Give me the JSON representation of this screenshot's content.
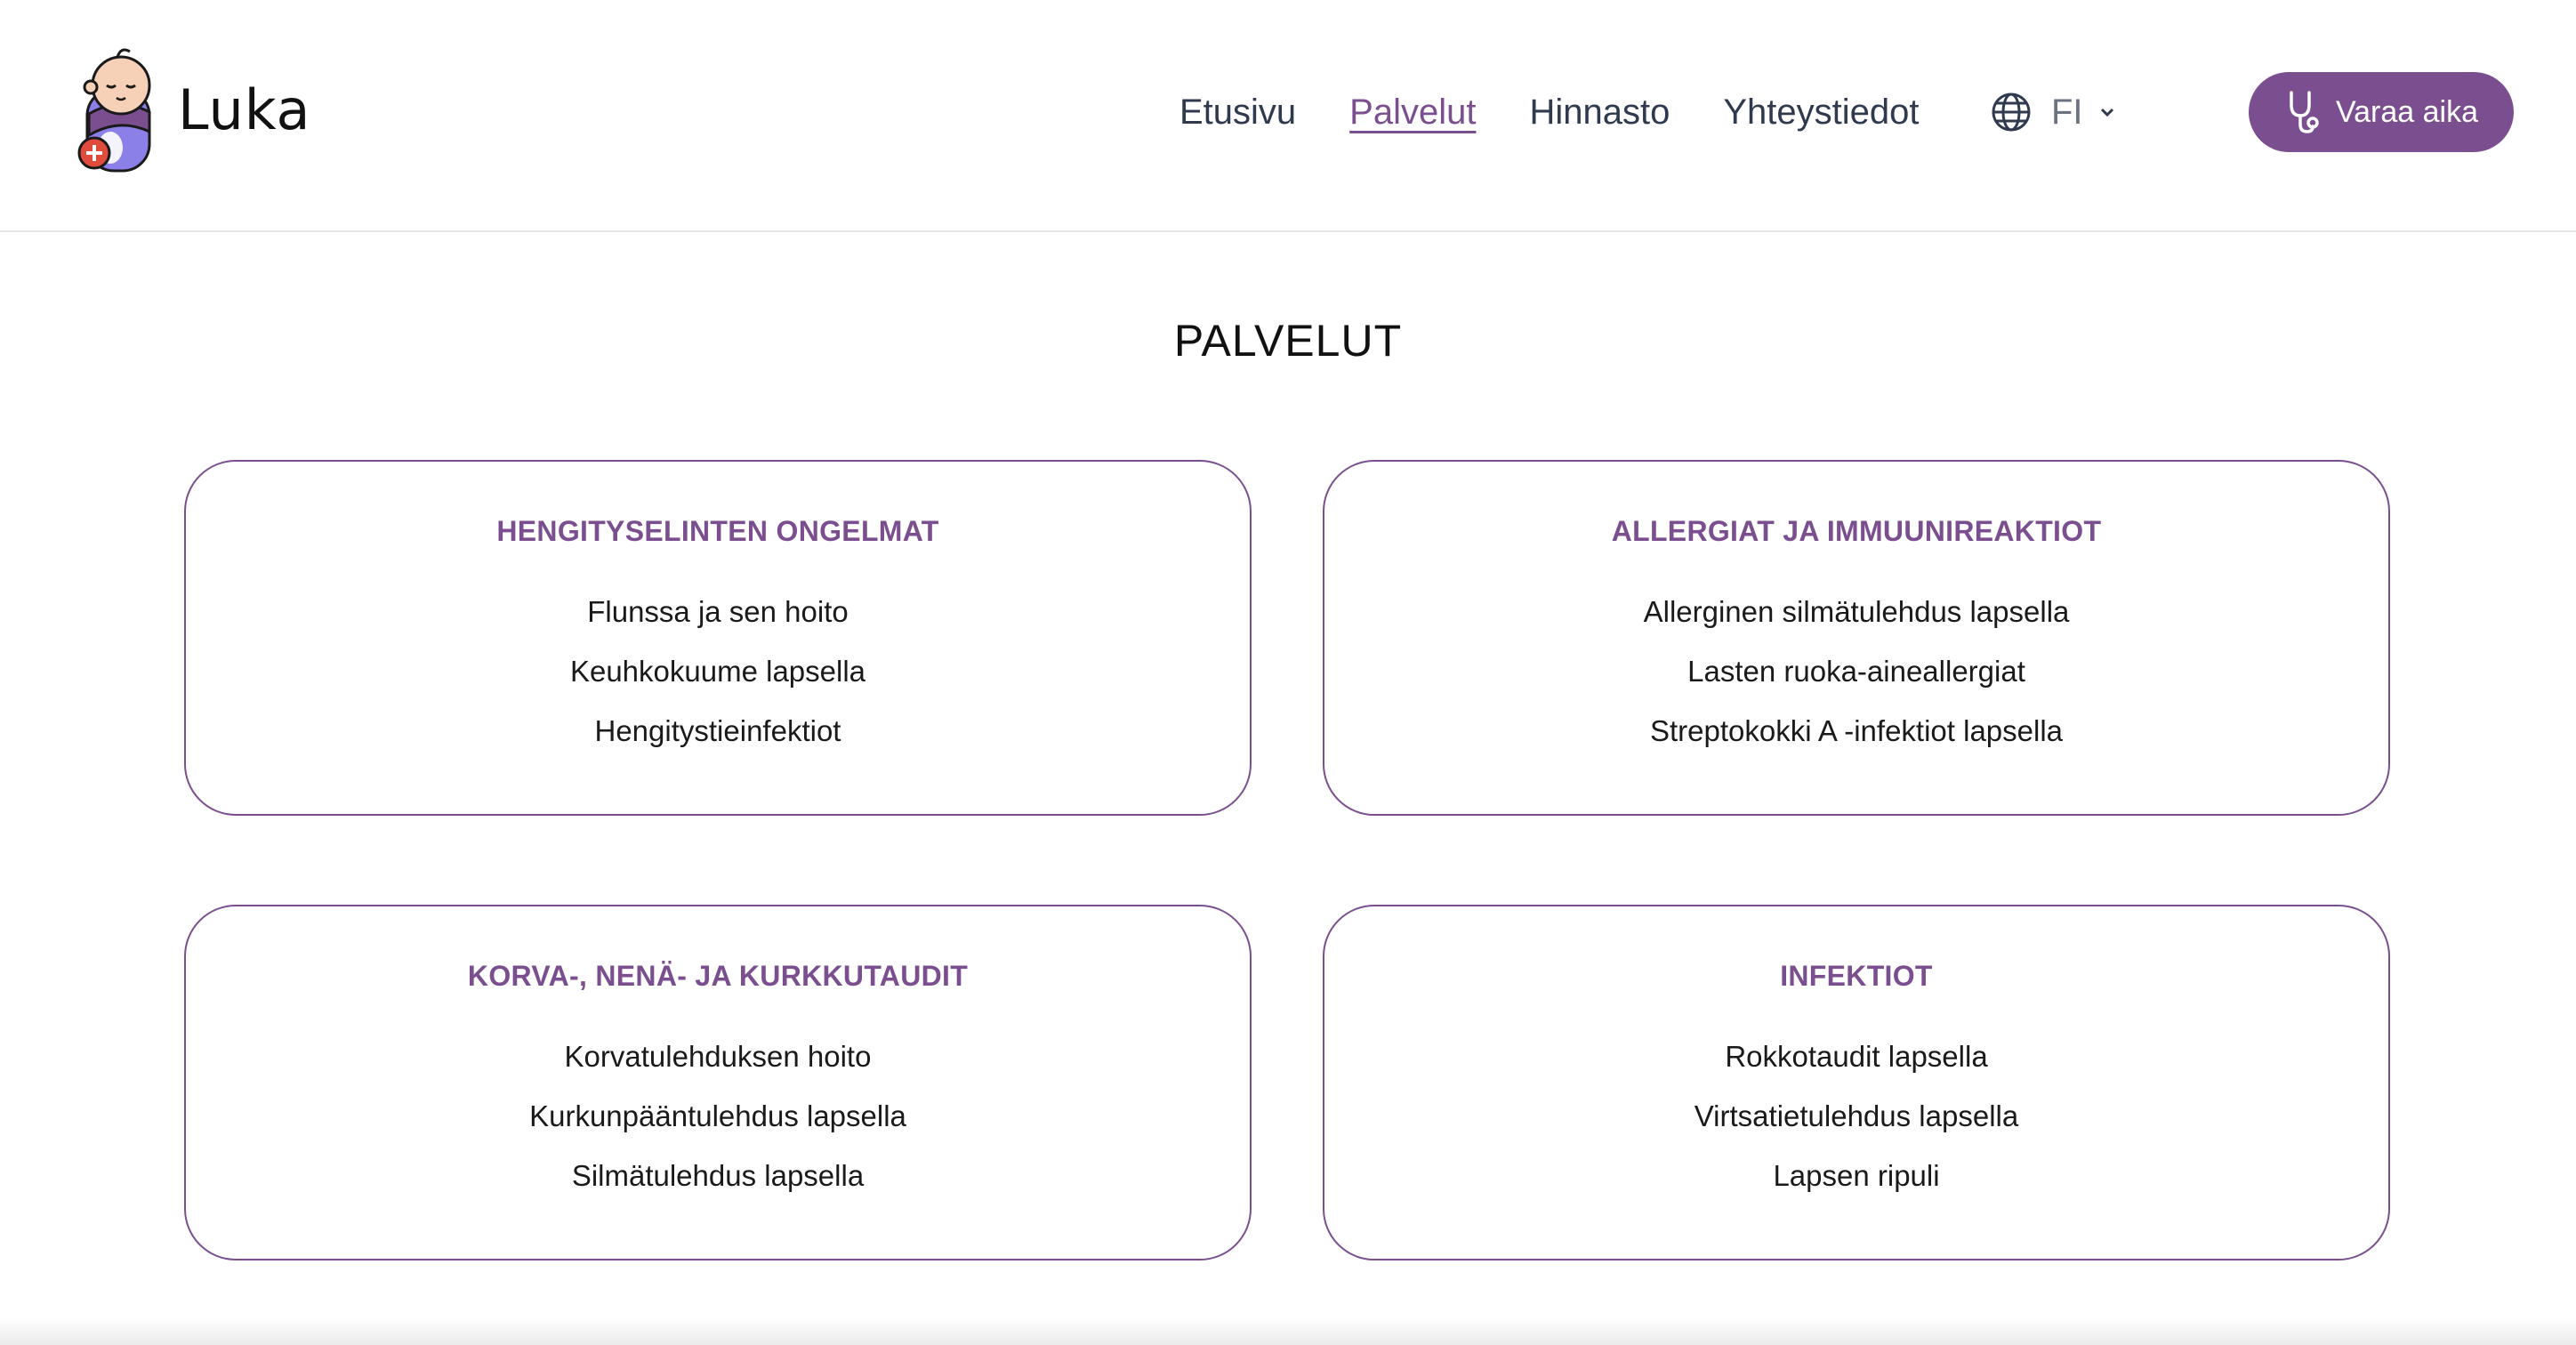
{
  "brand": {
    "name": "Luka",
    "accent": "#7b4f8f"
  },
  "nav": {
    "items": [
      {
        "label": "Etusivu",
        "active": false
      },
      {
        "label": "Palvelut",
        "active": true
      },
      {
        "label": "Hinnasto",
        "active": false
      },
      {
        "label": "Yhteystiedot",
        "active": false
      }
    ],
    "language": {
      "selected": "FI",
      "icon": "globe-icon"
    },
    "cta": {
      "label": "Varaa aika",
      "icon": "stethoscope-icon"
    }
  },
  "page": {
    "title": "PALVELUT",
    "cards": [
      {
        "title": "HENGITYSELINTEN ONGELMAT",
        "items": [
          "Flunssa ja sen hoito",
          "Keuhkokuume lapsella",
          "Hengitystieinfektiot"
        ]
      },
      {
        "title": "ALLERGIAT JA IMMUUNIREAKTIOT",
        "items": [
          "Allerginen silmätulehdus lapsella",
          "Lasten ruoka-aineallergiat",
          "Streptokokki A -infektiot lapsella"
        ]
      },
      {
        "title": "KORVA-, NENÄ- JA KURKKUTAUDIT",
        "items": [
          "Korvatulehduksen hoito",
          "Kurkunpääntulehdus lapsella",
          "Silmätulehdus lapsella"
        ]
      },
      {
        "title": "INFEKTIOT",
        "items": [
          "Rokkotaudit lapsella",
          "Virtsatietulehdus lapsella",
          "Lapsen ripuli"
        ]
      }
    ]
  }
}
